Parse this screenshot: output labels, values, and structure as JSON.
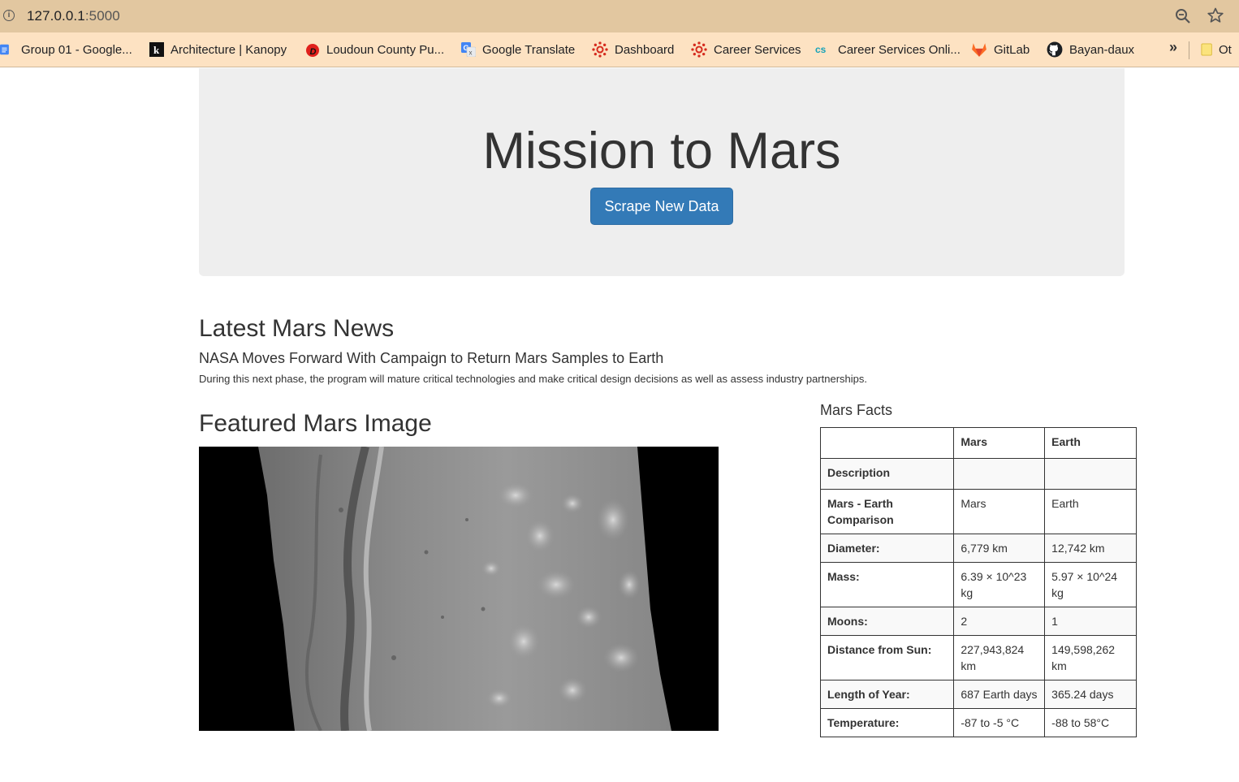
{
  "browser": {
    "url_host": "127.0.0.1",
    "url_port": ":5000",
    "bookmarks": [
      {
        "label": "Group 01 - Google...",
        "icon": "google-docs-icon"
      },
      {
        "label": "Architecture | Kanopy",
        "icon": "kanopy-icon"
      },
      {
        "label": "Loudoun County Pu...",
        "icon": "library-icon"
      },
      {
        "label": "Google Translate",
        "icon": "google-translate-icon"
      },
      {
        "label": "Dashboard",
        "icon": "canvas-icon"
      },
      {
        "label": "Career Services",
        "icon": "canvas-icon"
      },
      {
        "label": "Career Services Onli...",
        "icon": "cs-icon"
      },
      {
        "label": "GitLab",
        "icon": "gitlab-icon"
      },
      {
        "label": "Bayan-daux",
        "icon": "github-icon"
      }
    ],
    "more_label": "»",
    "other_bookmarks_label": "Ot"
  },
  "jumbotron": {
    "title": "Mission to Mars",
    "button_label": "Scrape New Data"
  },
  "news": {
    "heading": "Latest Mars News",
    "title": "NASA Moves Forward With Campaign to Return Mars Samples to Earth",
    "paragraph": "During this next phase, the program will mature critical technologies and make critical design decisions as well as assess industry partnerships."
  },
  "featured": {
    "heading": "Featured Mars Image"
  },
  "facts": {
    "heading": "Mars Facts",
    "columns": [
      "",
      "Mars",
      "Earth"
    ],
    "rows": [
      {
        "label": "Description",
        "mars": "",
        "earth": ""
      },
      {
        "label": "Mars - Earth Comparison",
        "mars": "Mars",
        "earth": "Earth"
      },
      {
        "label": "Diameter:",
        "mars": "6,779 km",
        "earth": "12,742 km"
      },
      {
        "label": "Mass:",
        "mars": "6.39 × 10^23 kg",
        "earth": "5.97 × 10^24 kg"
      },
      {
        "label": "Moons:",
        "mars": "2",
        "earth": "1"
      },
      {
        "label": "Distance from Sun:",
        "mars": "227,943,824 km",
        "earth": "149,598,262 km"
      },
      {
        "label": "Length of Year:",
        "mars": "687 Earth days",
        "earth": "365.24 days"
      },
      {
        "label": "Temperature:",
        "mars": "-87 to -5 °C",
        "earth": "-88 to 58°C"
      }
    ]
  }
}
